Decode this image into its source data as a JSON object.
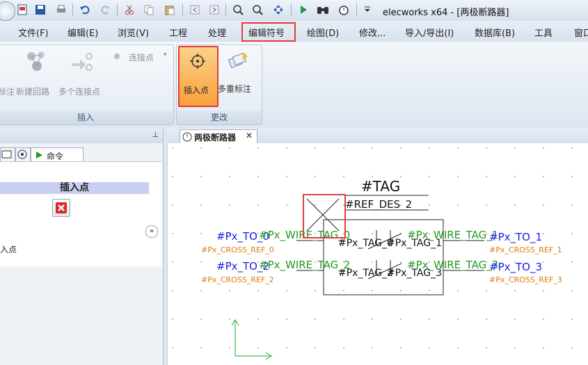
{
  "app": {
    "title": "elecworks x64 - [两极断路器]"
  },
  "quick_access": {
    "icons": [
      "app-orb-icon",
      "document-icon",
      "save-icon",
      "print-icon",
      "undo-icon",
      "redo-icon",
      "cut-icon",
      "copy-icon",
      "paste-icon",
      "back-icon",
      "forward-icon",
      "zoom-fit-icon",
      "zoom-icon",
      "pan-icon",
      "play-icon",
      "binoculars-icon",
      "timer-icon",
      "dropdown-icon"
    ]
  },
  "menu": {
    "items": [
      "文件(F)",
      "编辑(E)",
      "浏览(V)",
      "工程",
      "处理",
      "编辑符号",
      "绘图(D)",
      "修改...",
      "导入/导出(I)",
      "数据库(B)",
      "工具",
      "窗口"
    ],
    "active": "编辑符号"
  },
  "ribbon": {
    "group1": {
      "label": "插入",
      "connection_point": "连接点",
      "annotate": "标注",
      "new_circuit": "新建回路",
      "multi_connection": "多个连接点"
    },
    "group2": {
      "label": "更改",
      "insert_point": "插入点",
      "multi_annotate": "多重标注"
    }
  },
  "left_panel": {
    "tab_command": "命令",
    "section_title": "插入点",
    "item_label": "插入点"
  },
  "document": {
    "tab_title": "两极断路器",
    "close_glyph": "✕"
  },
  "symbol": {
    "tag": "#TAG",
    "ref_des": "#REF_DES_2",
    "to_0": "#Px_TO_0",
    "to_1": "#Px_TO_1",
    "to_2": "#Px_TO_2",
    "to_3": "#Px_TO_3",
    "cross_0": "#Px_CROSS_REF_0",
    "cross_1": "#Px_CROSS_REF_1",
    "cross_2": "#Px_CROSS_REF_2",
    "cross_3": "#Px_CROSS_REF_3",
    "wire_0": "#Px_WIRE_TAG_0",
    "wire_1": "#Px_WIRE_TAG_1",
    "wire_2": "#Px_WIRE_TAG_2",
    "wire_3": "#Px_WIRE_TAG_3",
    "inner_0": "#Px_TAG_0",
    "inner_1": "#Px_TAG_1",
    "inner_2": "#Px_TAG_2",
    "inner_3": "#Px_TAG_3"
  },
  "colors": {
    "highlight": "#e23b3b",
    "active_button": "#f7a13a",
    "blue_text": "#1a1ae6",
    "green_text": "#1f9a1f",
    "orange_text": "#e07a10"
  }
}
